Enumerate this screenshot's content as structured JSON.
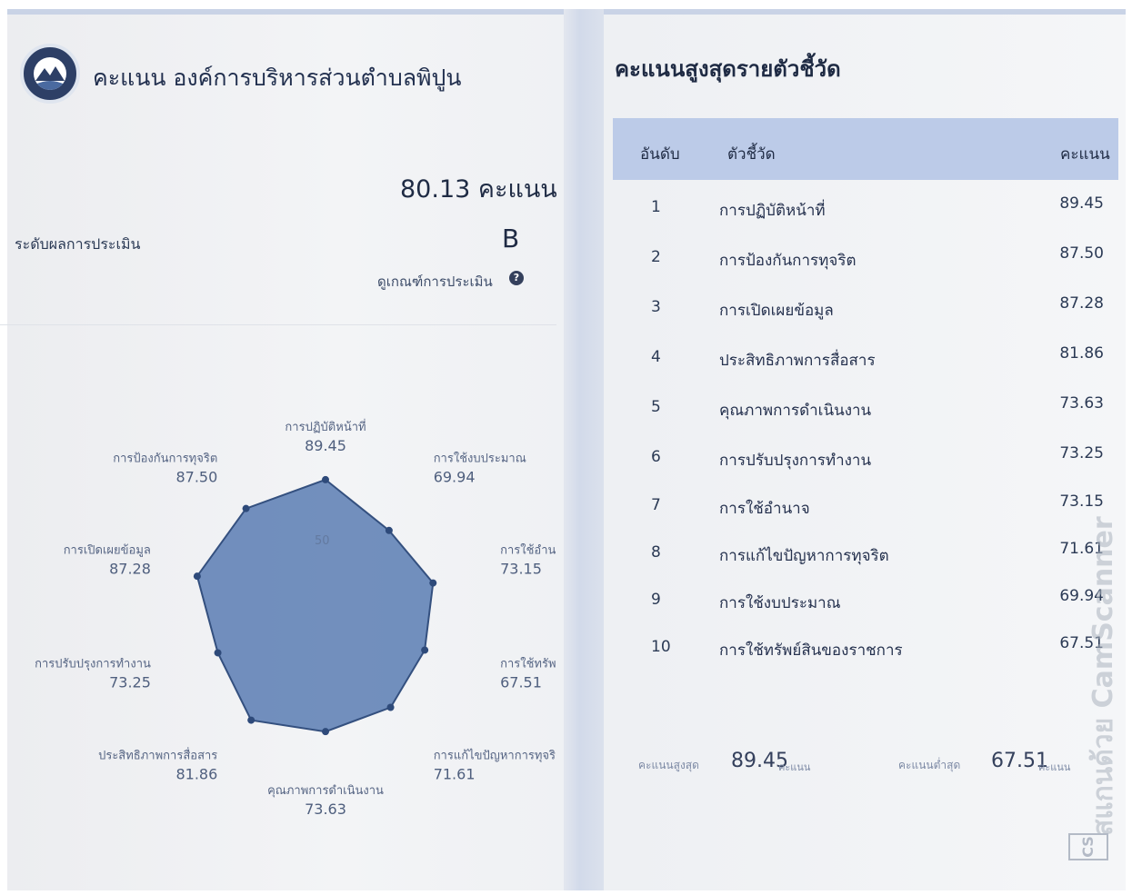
{
  "header": {
    "org_title": "คะแนน องค์การบริหารส่วนตำบลพิปูน",
    "logo_icon": "organization-seal-icon"
  },
  "summary": {
    "score_text": "80.13 คะแนน",
    "level_label": "ระดับผลการประเมิน",
    "grade": "B",
    "criteria_link": "ดูเกณฑ์การประเมิน",
    "help_icon": "question-circle-icon"
  },
  "chart_data": {
    "type": "radar",
    "title": "",
    "max": 100,
    "gridline_value_label": "50",
    "fill_color": "#5b7db3",
    "axes": [
      {
        "label": "การปฏิบัติหน้าที่",
        "value": 89.45,
        "value_text": "89.45"
      },
      {
        "label": "การใช้งบประมาณ",
        "value": 69.94,
        "value_text": "69.94"
      },
      {
        "label": "การใช้อำนาจ",
        "value": 73.15,
        "value_text": "73.15"
      },
      {
        "label": "การใช้ทรัพย์สินฯ",
        "value": 67.51,
        "value_text": "67.51"
      },
      {
        "label": "การแก้ไขปัญหาการทุจริต",
        "value": 71.61,
        "value_text": "71.61"
      },
      {
        "label": "คุณภาพการดำเนินงาน",
        "value": 73.63,
        "value_text": "73.63"
      },
      {
        "label": "ประสิทธิภาพการสื่อสาร",
        "value": 81.86,
        "value_text": "81.86"
      },
      {
        "label": "การปรับปรุงการทำงาน",
        "value": 73.25,
        "value_text": "73.25"
      },
      {
        "label": "การเปิดเผยข้อมูล",
        "value": 87.28,
        "value_text": "87.28"
      },
      {
        "label": "การป้องกันการทุจริต",
        "value": 87.5,
        "value_text": "87.50"
      }
    ]
  },
  "ranking": {
    "title": "คะแนนสูงสุดรายตัวชี้วัด",
    "col_rank": "อันดับ",
    "col_indicator": "ตัวชี้วัด",
    "col_score": "คะแนน",
    "rows": [
      {
        "rank": "1",
        "name": "การปฏิบัติหน้าที่",
        "score": "89.45"
      },
      {
        "rank": "2",
        "name": "การป้องกันการทุจริต",
        "score": "87.50"
      },
      {
        "rank": "3",
        "name": "การเปิดเผยข้อมูล",
        "score": "87.28"
      },
      {
        "rank": "4",
        "name": "ประสิทธิภาพการสื่อสาร",
        "score": "81.86"
      },
      {
        "rank": "5",
        "name": "คุณภาพการดำเนินงาน",
        "score": "73.63"
      },
      {
        "rank": "6",
        "name": "การปรับปรุงการทำงาน",
        "score": "73.25"
      },
      {
        "rank": "7",
        "name": "การใช้อำนาจ",
        "score": "73.15"
      },
      {
        "rank": "8",
        "name": "การแก้ไขปัญหาการทุจริต",
        "score": "71.61"
      },
      {
        "rank": "9",
        "name": "การใช้งบประมาณ",
        "score": "69.94"
      },
      {
        "rank": "10",
        "name": "การใช้ทรัพย์สินของราชการ",
        "score": "67.51"
      }
    ],
    "max_label": "คะแนนสูงสุด",
    "max_value": "89.45",
    "max_unit": "คะแนน",
    "min_label": "คะแนนต่ำสุด",
    "min_value": "67.51",
    "min_unit": "คะแนน"
  },
  "watermark": {
    "text": "สแกนด้วย CamScanner",
    "badge": "CS"
  },
  "colors": {
    "table_header": "#bccbe8",
    "radar_fill": "#5b7db3",
    "text_dark": "#1f2b44"
  }
}
